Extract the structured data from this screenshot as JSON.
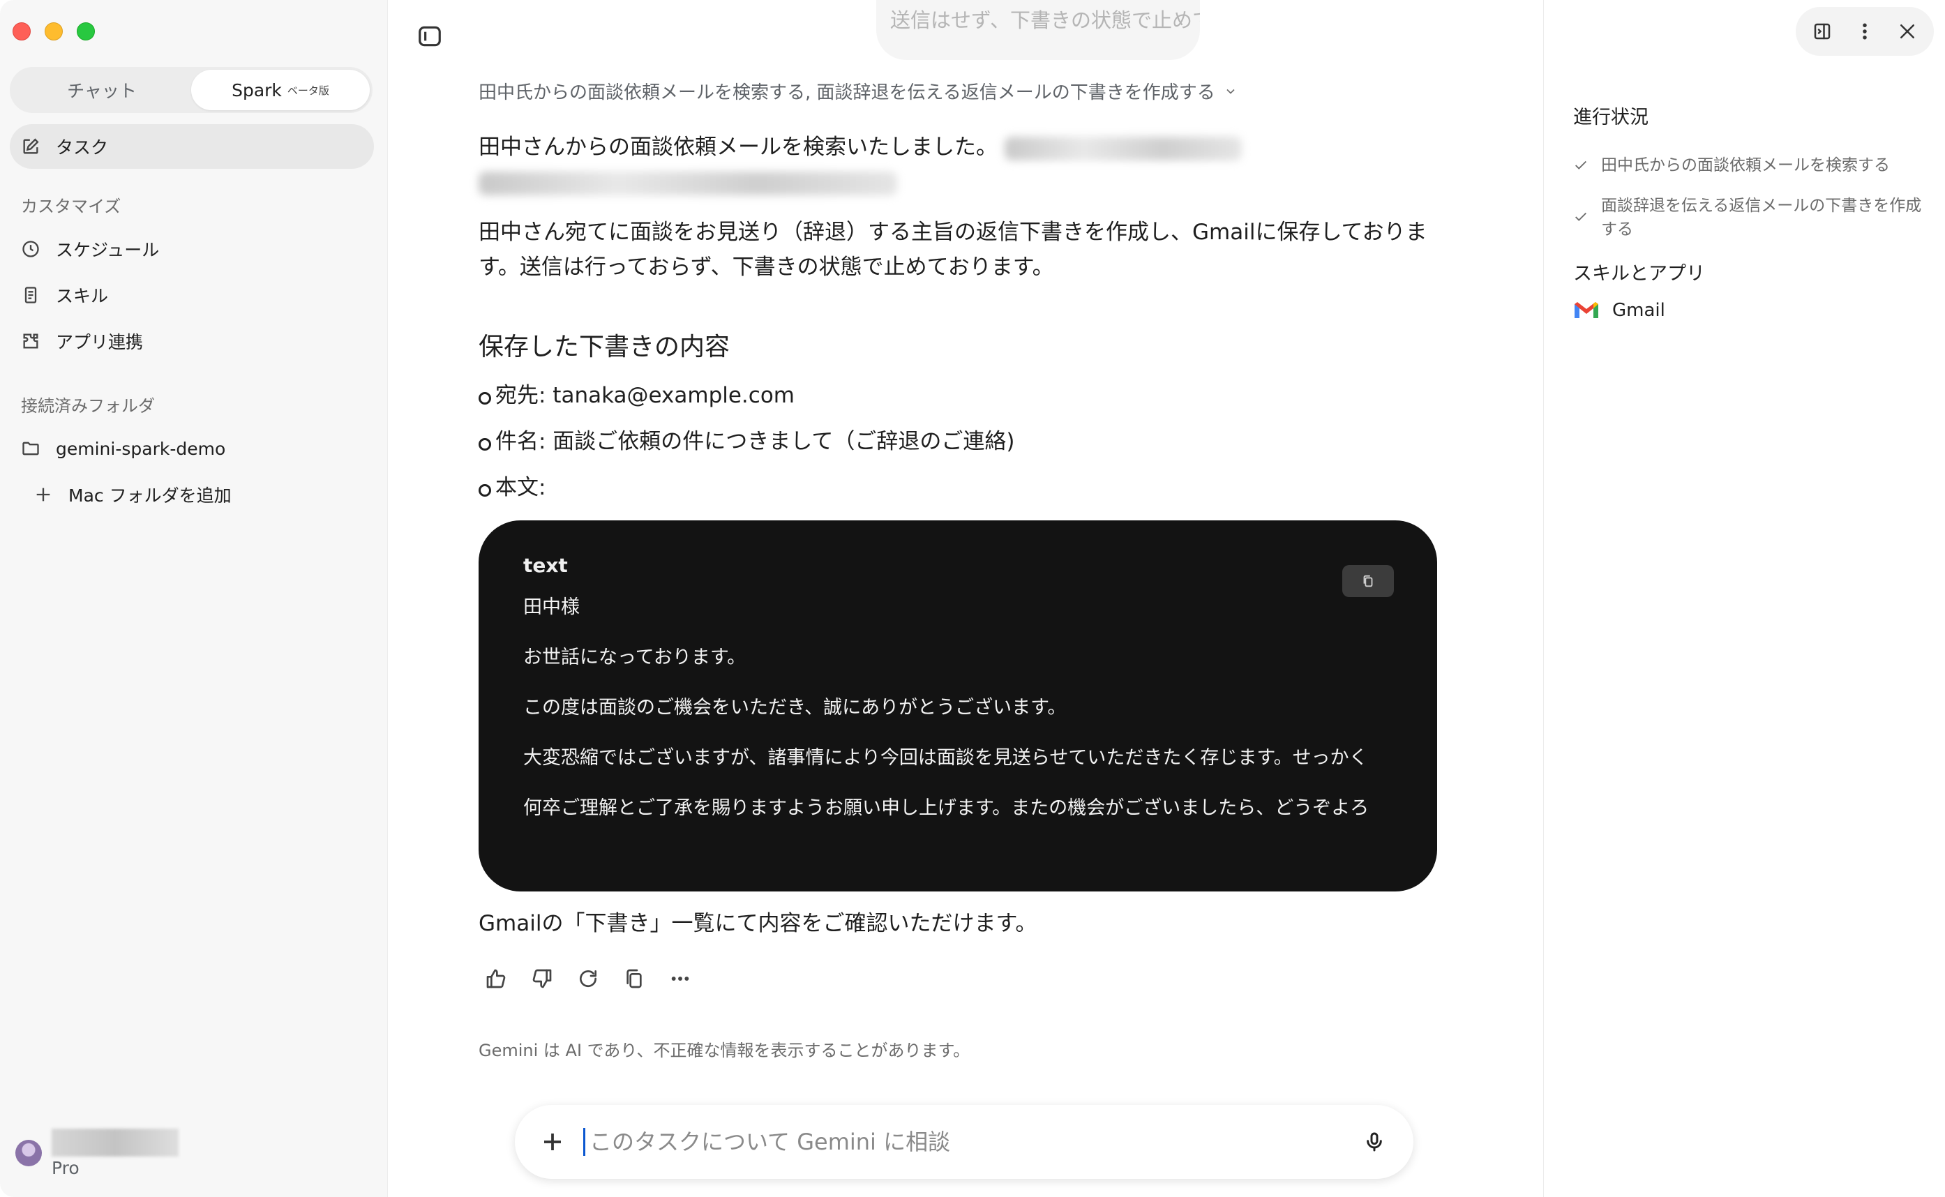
{
  "sidebar": {
    "mode_tabs": [
      {
        "label": "チャット",
        "active": false
      },
      {
        "label": "Spark",
        "badge": "ベータ版",
        "active": true
      }
    ],
    "tasks_label": "タスク",
    "customize_section": "カスタマイズ",
    "customize_items": [
      {
        "label": "スケジュール",
        "icon": "clock-icon"
      },
      {
        "label": "スキル",
        "icon": "document-icon"
      },
      {
        "label": "アプリ連携",
        "icon": "puzzle-icon"
      }
    ],
    "folders_section": "接続済みフォルダ",
    "folders": [
      {
        "label": "gemini-spark-demo",
        "icon": "folder-icon"
      }
    ],
    "add_folder_label": "Mac フォルダを追加",
    "user": {
      "plan": "Pro"
    }
  },
  "main": {
    "previous_message": "送信はせず、下書きの状態で止めてください。",
    "thought_header": "田中氏からの面談依頼メールを検索する, 面談辞退を伝える返信メールの下書きを作成する",
    "para1": "田中さんからの面談依頼メールを検索いたしました。",
    "para2": "田中さん宛てに面談をお見送り（辞退）する主旨の返信下書きを作成し、Gmailに保存しておりま",
    "para2b": "す。送信は行っておらず、下書きの状態で止めております。",
    "section_title": "保存した下書きの内容",
    "bullets": [
      "宛先: tanaka@example.com",
      "件名: 面談ご依頼の件につきまして（ご辞退のご連絡)",
      "本文:"
    ],
    "code": {
      "lang": "text",
      "lines": [
        "田中様",
        "お世話になっております。",
        "この度は面談のご機会をいただき、誠にありがとうございます。",
        "大変恐縮ではございますが、諸事情により今回は面談を見送らせていただきたく存じます。せっかく",
        "何卒ご理解とご了承を賜りますようお願い申し上げます。またの機会がございましたら、どうぞよろ"
      ]
    },
    "after_code": "Gmailの「下書き」一覧にて内容をご確認いただけます。",
    "disclaimer": "Gemini は AI であり、不正確な情報を表示することがあります。",
    "composer": {
      "placeholder": "このタスクについて Gemini に相談"
    }
  },
  "right_panel": {
    "progress_heading": "進行状況",
    "steps": [
      "田中氏からの面談依頼メールを検索する",
      "面談辞退を伝える返信メールの下書きを作成する"
    ],
    "skills_heading": "スキルとアプリ",
    "apps": [
      {
        "label": "Gmail",
        "icon": "gmail-icon"
      }
    ]
  },
  "colors": {
    "accent": "#0b57d0",
    "sidebar_bg": "#f7f7f7",
    "code_bg": "#131313",
    "gmail_red": "#ea4335"
  }
}
